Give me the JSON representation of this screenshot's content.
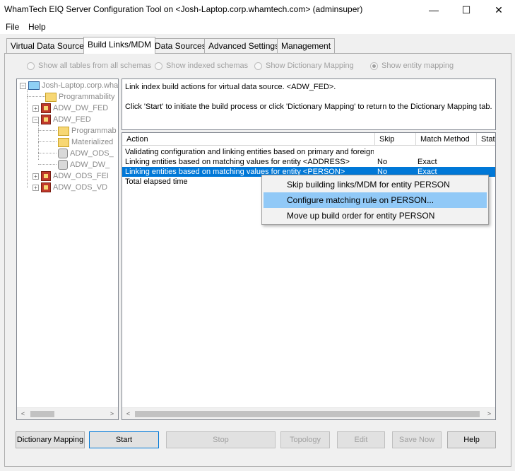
{
  "window": {
    "title": "WhamTech EIQ Server Configuration Tool on <Josh-Laptop.corp.whamtech.com> (adminsuper)",
    "minimize_glyph": "—",
    "maximize_glyph": "☐",
    "close_glyph": "✕"
  },
  "menu": [
    "File",
    "Help"
  ],
  "tabs": [
    "Virtual Data Sources",
    "Build Links/MDM",
    "Data Sources",
    "Advanced Settings",
    "Management"
  ],
  "active_tab": "Build Links/MDM",
  "radios": [
    {
      "label": "Show all tables from all schemas",
      "checked": false
    },
    {
      "label": "Show indexed schemas",
      "checked": false
    },
    {
      "label": "Show Dictionary Mapping",
      "checked": false
    },
    {
      "label": "Show entity mapping",
      "checked": true
    }
  ],
  "tree": {
    "root": "Josh-Laptop.corp.wha",
    "items": [
      "Programmability",
      "ADW_DW_FED",
      "ADW_FED",
      "Programmab",
      "Materialized",
      "ADW_ODS_",
      "ADW_DW_",
      "ADW_ODS_FEI",
      "ADW_ODS_VD"
    ]
  },
  "info": {
    "line1": "Link index build actions for virtual data source. <ADW_FED>.",
    "line2": "Click 'Start' to initiate the build process or click 'Dictionary Mapping' to return to the Dictionary Mapping tab."
  },
  "list": {
    "columns": [
      "Action",
      "Skip",
      "Match Method",
      "Stat"
    ],
    "rows": [
      {
        "action": "Validating configuration and linking entities based on primary and foreign ...",
        "skip": "",
        "method": ""
      },
      {
        "action": "Linking entities based on matching values for entity <ADDRESS>",
        "skip": "No",
        "method": "Exact"
      },
      {
        "action": "Linking entities based on matching values for entity <PERSON>",
        "skip": "No",
        "method": "Exact"
      },
      {
        "action": "Total elapsed time",
        "skip": "",
        "method": ""
      }
    ],
    "selected_row": 2
  },
  "context_menu": {
    "items": [
      "Skip building links/MDM  for entity PERSON",
      "Configure matching rule on PERSON...",
      "Move up build order for entity PERSON"
    ],
    "hover_index": 1
  },
  "buttons": {
    "dictionary_mapping": "Dictionary Mapping",
    "start": "Start",
    "stop": "Stop",
    "topology": "Topology",
    "edit": "Edit",
    "save_now": "Save Now",
    "help": "Help"
  },
  "scroll_arrows": {
    "left": "<",
    "right": ">"
  },
  "colors": {
    "selection": "#0078d7",
    "menu_hover": "#91c9f7",
    "disabled_text": "#a0a0a0"
  }
}
